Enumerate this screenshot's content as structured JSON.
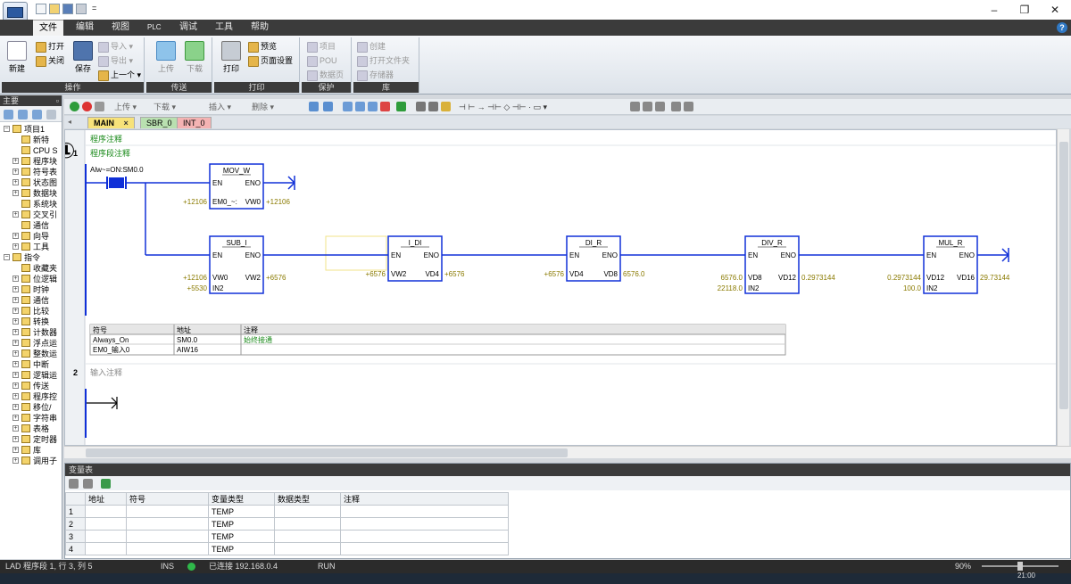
{
  "window": {
    "qa_separator": "=",
    "minimize": "–",
    "restore": "❐",
    "close": "✕",
    "help": "?"
  },
  "menu": [
    "文件",
    "编辑",
    "视图",
    "PLC",
    "调试",
    "工具",
    "帮助"
  ],
  "ribbon": {
    "groups": [
      {
        "label": "操作",
        "big": [
          "新建",
          "保存"
        ],
        "small": [
          "打开",
          "关闭",
          "导入 ▾",
          "导出 ▾",
          "上一个 ▾"
        ]
      },
      {
        "label": "传送",
        "big": [
          "上传",
          "下载"
        ]
      },
      {
        "label": "打印",
        "big": [
          "打印"
        ],
        "small": [
          "预览",
          "页面设置"
        ]
      },
      {
        "label": "保护",
        "small": [
          "项目",
          "POU",
          "数据页"
        ]
      },
      {
        "label": "库",
        "small": [
          "创建",
          "打开文件夹",
          "存储器"
        ]
      }
    ]
  },
  "left": {
    "title": "主要",
    "pin": "▫",
    "tree": [
      {
        "label": "项目1",
        "indent": 0,
        "expand": "−"
      },
      {
        "label": "新特",
        "indent": 1,
        "expand": ""
      },
      {
        "label": "CPU S",
        "indent": 1,
        "expand": ""
      },
      {
        "label": "程序块",
        "indent": 1,
        "expand": "+"
      },
      {
        "label": "符号表",
        "indent": 1,
        "expand": "+"
      },
      {
        "label": "状态图",
        "indent": 1,
        "expand": "+"
      },
      {
        "label": "数据块",
        "indent": 1,
        "expand": "+"
      },
      {
        "label": "系统块",
        "indent": 1,
        "expand": ""
      },
      {
        "label": "交叉引",
        "indent": 1,
        "expand": "+"
      },
      {
        "label": "通信",
        "indent": 1,
        "expand": ""
      },
      {
        "label": "向导",
        "indent": 1,
        "expand": "+"
      },
      {
        "label": "工具",
        "indent": 1,
        "expand": "+"
      },
      {
        "label": "指令",
        "indent": 0,
        "expand": "−"
      },
      {
        "label": "收藏夹",
        "indent": 1,
        "expand": ""
      },
      {
        "label": "位逻辑",
        "indent": 1,
        "expand": "+"
      },
      {
        "label": "时钟",
        "indent": 1,
        "expand": "+"
      },
      {
        "label": "通信",
        "indent": 1,
        "expand": "+"
      },
      {
        "label": "比较",
        "indent": 1,
        "expand": "+"
      },
      {
        "label": "转换",
        "indent": 1,
        "expand": "+"
      },
      {
        "label": "计数器",
        "indent": 1,
        "expand": "+"
      },
      {
        "label": "浮点运",
        "indent": 1,
        "expand": "+"
      },
      {
        "label": "整数运",
        "indent": 1,
        "expand": "+"
      },
      {
        "label": "中断",
        "indent": 1,
        "expand": "+"
      },
      {
        "label": "逻辑运",
        "indent": 1,
        "expand": "+"
      },
      {
        "label": "传送",
        "indent": 1,
        "expand": "+"
      },
      {
        "label": "程序控",
        "indent": 1,
        "expand": "+"
      },
      {
        "label": "移位/",
        "indent": 1,
        "expand": "+"
      },
      {
        "label": "字符串",
        "indent": 1,
        "expand": "+"
      },
      {
        "label": "表格",
        "indent": 1,
        "expand": "+"
      },
      {
        "label": "定时器",
        "indent": 1,
        "expand": "+"
      },
      {
        "label": "库",
        "indent": 1,
        "expand": "+"
      },
      {
        "label": "调用子",
        "indent": 1,
        "expand": "+"
      }
    ]
  },
  "edtool": {
    "upload": "上传 ▾",
    "download": "下载 ▾",
    "insert": "插入 ▾",
    "delete": "删除 ▾"
  },
  "tabs": [
    {
      "label": "MAIN",
      "close": "×",
      "color": "#f7e27a"
    },
    {
      "label": "SBR_0",
      "close": "",
      "color": "#b9e0b0"
    },
    {
      "label": "INT_0",
      "close": "",
      "color": "#f4b3b3"
    }
  ],
  "editor": {
    "program_comment": "程序注释",
    "marker": "①",
    "net1_num": "1",
    "net1_comment": "程序段注释",
    "contact_label": "Alw~=ON:SM0.0",
    "net2_num": "2",
    "net2_comment": "输入注释",
    "boxes": [
      {
        "title": "MOV_W",
        "in1": "EM0_~:",
        "out1": "VW0",
        "in1_val": "+12106",
        "out1_val": "+12106"
      },
      {
        "title": "SUB_I",
        "in1": "VW0",
        "in2": "IN2",
        "out1": "VW2",
        "in1_val": "+12106",
        "in2_val": "+5530",
        "out1_val": "+6576"
      },
      {
        "title": "I_DI",
        "in1": "VW2",
        "out1": "VD4",
        "in1_val": "+6576",
        "out1_val": "+6576"
      },
      {
        "title": "DI_R",
        "in1": "VD4",
        "out1": "VD8",
        "in1_val": "+6576",
        "out1_val": "6576.0"
      },
      {
        "title": "DIV_R",
        "in1": "VD8",
        "in2": "IN2",
        "out1": "VD12",
        "in1_val": "6576.0",
        "in2_val": "22118.0",
        "out1_val": "0.2973144"
      },
      {
        "title": "MUL_R",
        "in1": "VD12",
        "in2": "IN2",
        "out1": "VD16",
        "in1_val": "0.2973144",
        "in2_val": "100.0",
        "out1_val": "29.73144"
      }
    ],
    "en": "EN",
    "eno": "ENO",
    "symtable": {
      "headers": [
        "符号",
        "地址",
        "注释"
      ],
      "rows": [
        [
          "Always_On",
          "SM0.0",
          "始终接通"
        ],
        [
          "EM0_输入0",
          "AIW16",
          ""
        ]
      ]
    }
  },
  "vartable": {
    "title": "变量表",
    "headers": [
      "",
      "地址",
      "符号",
      "变量类型",
      "数据类型",
      "注释"
    ],
    "rows": [
      [
        "1",
        "",
        "",
        "TEMP",
        "",
        ""
      ],
      [
        "2",
        "",
        "",
        "TEMP",
        "",
        ""
      ],
      [
        "3",
        "",
        "",
        "TEMP",
        "",
        ""
      ],
      [
        "4",
        "",
        "",
        "TEMP",
        "",
        ""
      ]
    ]
  },
  "status": {
    "position": "LAD 程序段 1, 行 3, 列 5",
    "mode": "INS",
    "connection": "已连接 192.168.0.4",
    "run": "RUN",
    "zoom": "90%",
    "time": "21:00"
  },
  "colors": {
    "wire": "#1030d8",
    "value": "#8a7a00",
    "comment": "#1a8a1a"
  }
}
